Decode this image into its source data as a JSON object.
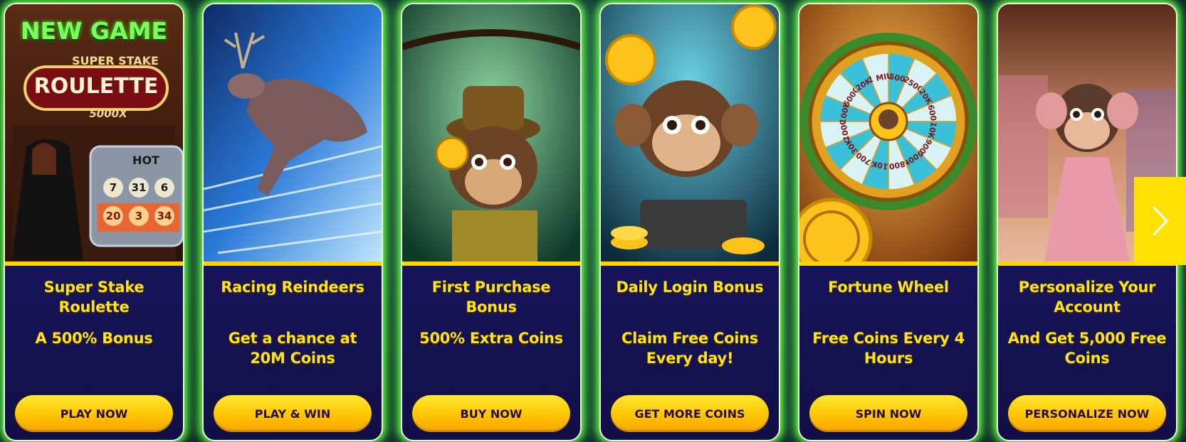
{
  "cards": [
    {
      "title": "Super Stake Roulette",
      "subtitle": "A 500% Bonus",
      "cta": "PLAY NOW",
      "art": {
        "badge": "NEW GAME",
        "game_super": "SUPER STAKE",
        "game_name": "ROULETTE",
        "game_mult": "5000X",
        "hot": "HOT",
        "numbers": [
          "7",
          "31",
          "6",
          "20",
          "3",
          "34"
        ]
      }
    },
    {
      "title": "Racing Reindeers",
      "subtitle": "Get a chance at 20M Coins",
      "cta": "PLAY & WIN"
    },
    {
      "title": "First Purchase Bonus",
      "subtitle": "500% Extra Coins",
      "cta": "BUY NOW"
    },
    {
      "title": "Daily Login Bonus",
      "subtitle": "Claim Free Coins Every day!",
      "cta": "GET MORE COINS"
    },
    {
      "title": "Fortune Wheel",
      "subtitle": "Free Coins Every 4 Hours",
      "cta": "SPIN NOW",
      "art": {
        "wheel_values": [
          "500",
          "2500",
          "20K",
          "600",
          "10K",
          "900",
          "500K",
          "800",
          "10K",
          "700",
          "30K",
          "1000",
          "100K",
          "5000",
          "20K",
          "1 MIL"
        ]
      }
    },
    {
      "title": "Personalize Your Account",
      "subtitle": "And Get 5,000 Free Coins",
      "cta": "PERSONALIZE NOW"
    }
  ],
  "carousel": {
    "next_icon": "chevron-right-icon"
  },
  "colors": {
    "title_yellow": "#ffe21a",
    "card_bg": "#1e1a6e",
    "glow": "#6dff4a",
    "button": "#ffc400"
  }
}
